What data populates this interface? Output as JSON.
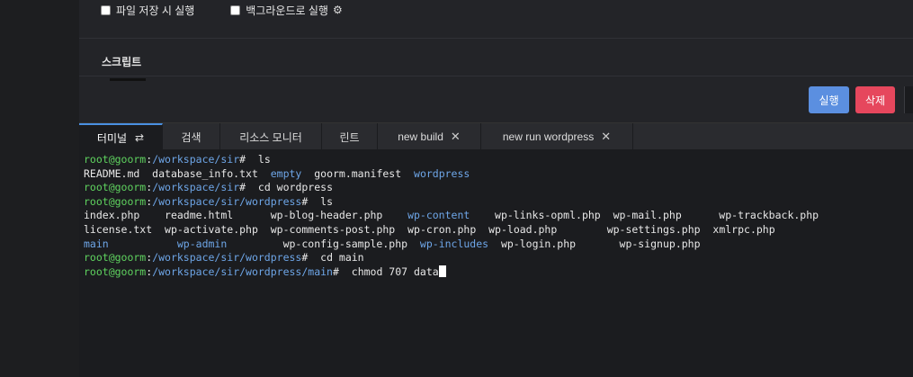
{
  "options": {
    "save_on_file_run": "파일 저장 시 실행",
    "run_in_background": "백그라운드로 실행"
  },
  "script_section": {
    "label": "스크립트"
  },
  "buttons": {
    "run": "실행",
    "delete": "삭제"
  },
  "tabs": [
    {
      "label": "터미널"
    },
    {
      "label": "검색"
    },
    {
      "label": "리소스 모니터"
    },
    {
      "label": "린트"
    },
    {
      "label": "new build"
    },
    {
      "label": "new run wordpress"
    }
  ],
  "terminal": {
    "prompt_user": "root@goorm",
    "lines": [
      {
        "path": "/workspace/sir",
        "cmd": " ls"
      },
      {
        "path": "/workspace/sir",
        "cmd": " cd wordpress"
      },
      {
        "path": "/workspace/sir/wordpress",
        "cmd": " ls"
      },
      {
        "path": "/workspace/sir/wordpress",
        "cmd": " cd main"
      },
      {
        "path": "/workspace/sir/wordpress/main",
        "cmd": "  chmod 707 data"
      }
    ],
    "ls_sir": {
      "f1": "README.md",
      "f2": "database_info.txt",
      "d1": "empty",
      "f3": "goorm.manifest",
      "d2": "wordpress"
    },
    "ls_wp": {
      "r1": [
        "index.php",
        "readme.html",
        "wp-blog-header.php",
        "wp-content",
        "wp-links-opml.php",
        "wp-mail.php",
        "wp-trackback.php"
      ],
      "r2": [
        "license.txt",
        "wp-activate.php",
        "wp-comments-post.php",
        "wp-cron.php",
        "wp-load.php",
        "wp-settings.php",
        "xmlrpc.php"
      ],
      "r3": [
        "main",
        "wp-admin",
        "wp-config-sample.php",
        "wp-includes",
        "wp-login.php",
        "wp-signup.php"
      ]
    }
  },
  "colors": {
    "run_button": "#5b8fe0",
    "delete_button": "#e6475d",
    "prompt_green": "#5fd35f",
    "dir_blue": "#6ea6e8",
    "active_tab_accent": "#4a90e2"
  }
}
